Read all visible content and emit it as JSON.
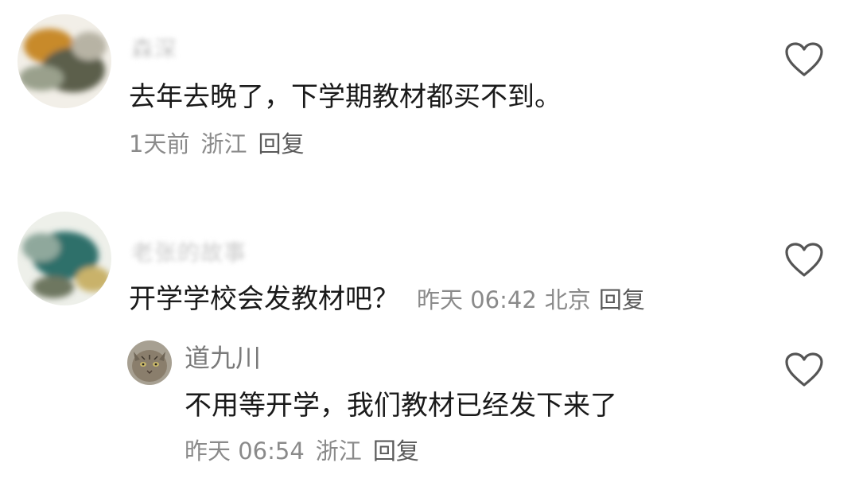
{
  "comments": [
    {
      "author": "森深",
      "text": "去年去晚了，下学期教材都买不到。",
      "time": "1天前",
      "location": "浙江",
      "reply_label": "回复"
    },
    {
      "author": "老张的故事",
      "text": "开学学校会发教材吧？",
      "time": "昨天 06:42",
      "location": "北京",
      "reply_label": "回复",
      "replies": [
        {
          "author": "道九川",
          "text": "不用等开学，我们教材已经发下来了",
          "time": "昨天 06:54",
          "location": "浙江",
          "reply_label": "回复"
        }
      ]
    }
  ],
  "icons": {
    "like": "heart-outline-icon"
  },
  "colors": {
    "text": "#1a1a1a",
    "meta": "#8a8a8a",
    "icon": "#555555"
  }
}
